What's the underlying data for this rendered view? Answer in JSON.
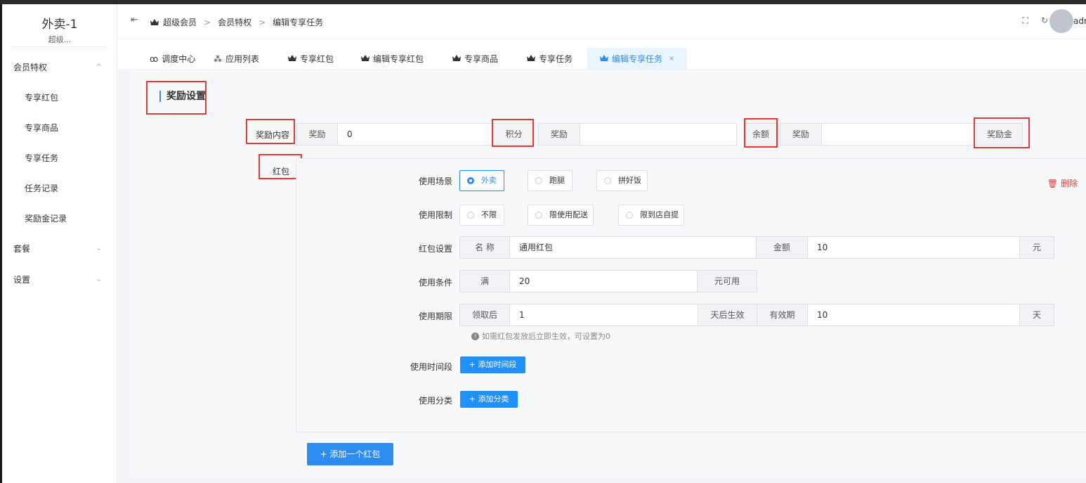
{
  "brand": {
    "title": "外卖-1",
    "subtitle": "超级..."
  },
  "sidebar": {
    "items": [
      {
        "label": "会员特权",
        "chevron": "^"
      },
      {
        "label": "专享红包"
      },
      {
        "label": "专享商品"
      },
      {
        "label": "专享任务"
      },
      {
        "label": "任务记录"
      },
      {
        "label": "奖励金记录"
      },
      {
        "label": "套餐",
        "chevron": "v"
      },
      {
        "label": "设置",
        "chevron": "v"
      }
    ]
  },
  "header": {
    "breadcrumb": [
      "超级会员",
      "会员特权",
      "编辑专享任务"
    ],
    "separator": ">",
    "user": "adr"
  },
  "tabs": [
    {
      "label": "调度中心"
    },
    {
      "label": "应用列表"
    },
    {
      "label": "专享红包"
    },
    {
      "label": "编辑专享红包"
    },
    {
      "label": "专享商品"
    },
    {
      "label": "专享任务"
    },
    {
      "label": "编辑专享任务",
      "active": true,
      "close": "×"
    }
  ],
  "form": {
    "section_title": "奖励设置",
    "reward_label": "奖励内容",
    "reward_prefix_1": "奖励",
    "reward_value_1": "0",
    "reward_suffix_1": "积分",
    "reward_prefix_2": "奖励",
    "reward_value_2": "",
    "reward_suffix_2": "余额",
    "reward_prefix_3": "奖励",
    "reward_value_3": "",
    "reward_suffix_3": "奖励金",
    "redpacket_label": "红包",
    "scene_label": "使用场景",
    "scene_options": [
      "外卖",
      "跑腿",
      "拼好饭"
    ],
    "scene_selected": "外卖",
    "limit_label": "使用限制",
    "limit_options": [
      "不限",
      "限使用配送",
      "限到店自提"
    ],
    "delete_label": "删除",
    "setting_label": "红包设置",
    "name_label": "名 称",
    "name_value": "通用红包",
    "amount_label": "金额",
    "amount_value": "10",
    "amount_unit": "元",
    "condition_label": "使用条件",
    "condition_prefix": "满",
    "condition_value": "20",
    "condition_suffix": "元可用",
    "period_label": "使用期限",
    "period_prefix": "领取后",
    "period_value": "1",
    "period_suffix": "天后生效",
    "valid_label": "有效期",
    "valid_value": "10",
    "valid_unit": "天",
    "hint": "如需红包发放后立即生效，可设置为0",
    "time_label": "使用时间段",
    "time_button": "+ 添加时间段",
    "category_label": "使用分类",
    "category_button": "+ 添加分类",
    "add_redpacket_button": "+ 添加一个红包"
  },
  "colors": {
    "accent": "#2d8cf0",
    "highlight": "#e53935",
    "danger": "#e53935"
  }
}
